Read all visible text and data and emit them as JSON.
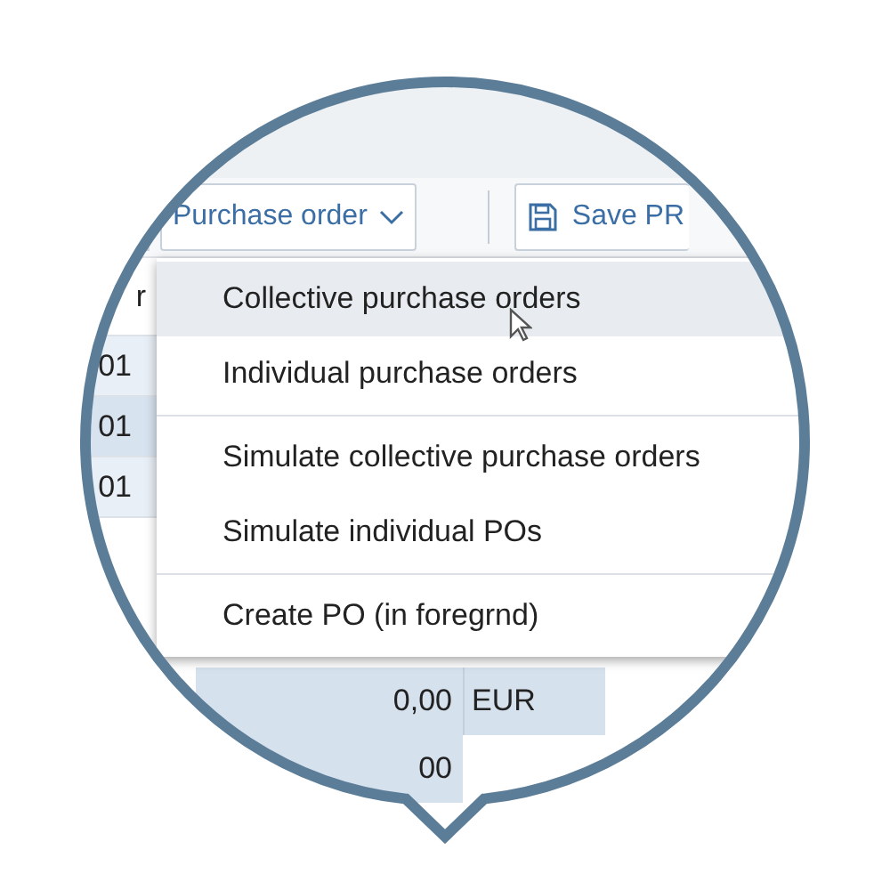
{
  "toolbar": {
    "buttons": [
      {
        "label": "Purchase order",
        "kind": "menu"
      },
      {
        "label": "Save PR",
        "kind": "save"
      }
    ]
  },
  "table": {
    "column_header": "r",
    "rows": [
      {
        "cell": "01"
      },
      {
        "cell": "01"
      },
      {
        "cell": "01"
      }
    ],
    "amount_rows": [
      {
        "amount": "0,00",
        "currency": "EUR"
      },
      {
        "amount": "00"
      }
    ]
  },
  "menu": {
    "items": [
      {
        "label": "Collective purchase orders",
        "hovered": true,
        "separator_before": false
      },
      {
        "label": "Individual purchase orders",
        "hovered": false,
        "separator_before": false
      },
      {
        "label": "Simulate collective purchase orders",
        "hovered": false,
        "separator_before": true
      },
      {
        "label": "Simulate individual POs",
        "hovered": false,
        "separator_before": false
      },
      {
        "label": "Create PO (in foregrnd)",
        "hovered": false,
        "separator_before": true
      }
    ]
  }
}
